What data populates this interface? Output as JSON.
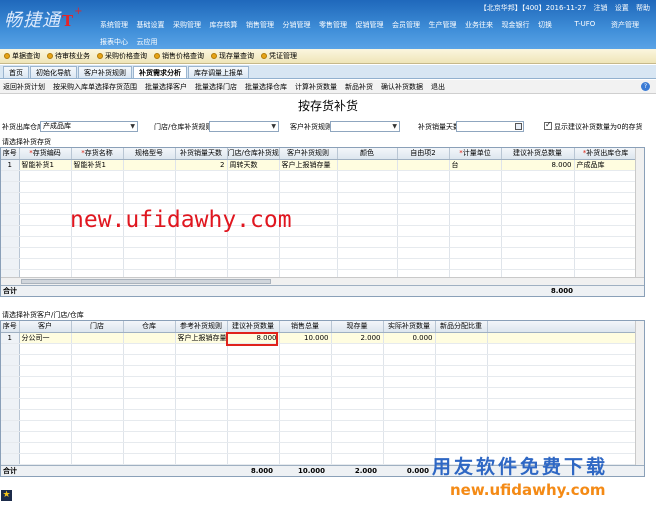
{
  "app": {
    "logo_text": "畅捷通",
    "logo_t": "T",
    "logo_plus": "+",
    "company": "【北京华邦】【400】2016-11-27",
    "user_items": [
      "注销",
      "设置",
      "帮助"
    ]
  },
  "nav": {
    "row1": [
      "系统管理",
      "基础设置",
      "采购管理",
      "库存核算",
      "销售管理",
      "分销管理",
      "零售管理",
      "促销管理",
      "会员管理",
      "生产管理",
      "业务往来",
      "现金银行",
      "切换",
      "T-UFO",
      "资产管理"
    ],
    "row2": [
      "报表中心",
      "云应用"
    ]
  },
  "quickbar": [
    "单据查询",
    "待审核业务",
    "采购价格查询",
    "销售价格查询",
    "现存量查询",
    "凭证管理"
  ],
  "tabs": [
    {
      "label": "首页",
      "active": false
    },
    {
      "label": "初始化导航",
      "active": false
    },
    {
      "label": "客户补货规则",
      "active": false
    },
    {
      "label": "补货需求分析",
      "active": true
    },
    {
      "label": "库存调量上报单",
      "active": false
    }
  ],
  "toolbar": [
    "返回补货计划",
    "按采购入库单选择存货范围",
    "批量选择客户",
    "批量选择门店",
    "批量选择仓库",
    "计算补货数量",
    "新品补货",
    "确认补货数据",
    "退出"
  ],
  "page_title": "按存货补货",
  "filters": {
    "warehouse_label": "补货出库仓库",
    "warehouse_value": "产成品库",
    "store_rule_label": "门店/仓库补货规则",
    "store_rule_value": "",
    "customer_rule_label": "客户补货规则",
    "customer_rule_value": "",
    "days_label": "补货销量天数",
    "days_value": "",
    "show_zero_label": "显示建议补货数量为0的存货",
    "show_zero_checked": true
  },
  "upper_grid": {
    "caption": "请选择补货存货",
    "columns": [
      "序号",
      "存货编码",
      "存货名称",
      "规格型号",
      "补货销量天数",
      "门店/仓库补货规则",
      "客户补货规则",
      "颜色",
      "自由项2",
      "计量单位",
      "建议补货总数量",
      "补货出库仓库"
    ],
    "required": [
      false,
      true,
      true,
      false,
      false,
      false,
      false,
      false,
      false,
      true,
      false,
      true
    ],
    "rows": [
      [
        "1",
        "智能补货1",
        "智能补货1",
        "",
        "2",
        "周转天数",
        "客户上报销存量",
        "",
        "",
        "台",
        "8.000",
        "产成品库"
      ]
    ],
    "empty_row_count": 14,
    "total_label": "合计",
    "total_qty": "8.000"
  },
  "lower_grid": {
    "caption": "请选择补货客户/门店/仓库",
    "columns": [
      "序号",
      "客户",
      "门店",
      "仓库",
      "参考补货规则",
      "建议补货数量",
      "销售总量",
      "现存量",
      "实际补货数量",
      "新品分配比重"
    ],
    "rows": [
      [
        "1",
        "分公司一",
        "",
        "",
        "客户上报销存量",
        "8.000",
        "10.000",
        "2.000",
        "0.000",
        ""
      ]
    ],
    "empty_row_count": 11,
    "total_label": "合计",
    "totals": [
      "8.000",
      "10.000",
      "2.000",
      "0.000"
    ]
  },
  "watermark": "new.ufidawhy.com",
  "brand_cn": "用友软件免费下载",
  "brand_url": "new.ufidawhy.com",
  "colors": {
    "header_blue": "#2f7fd0",
    "highlight_red": "#e0221c",
    "brand_blue": "#2e67c4",
    "brand_orange": "#f48a15"
  }
}
